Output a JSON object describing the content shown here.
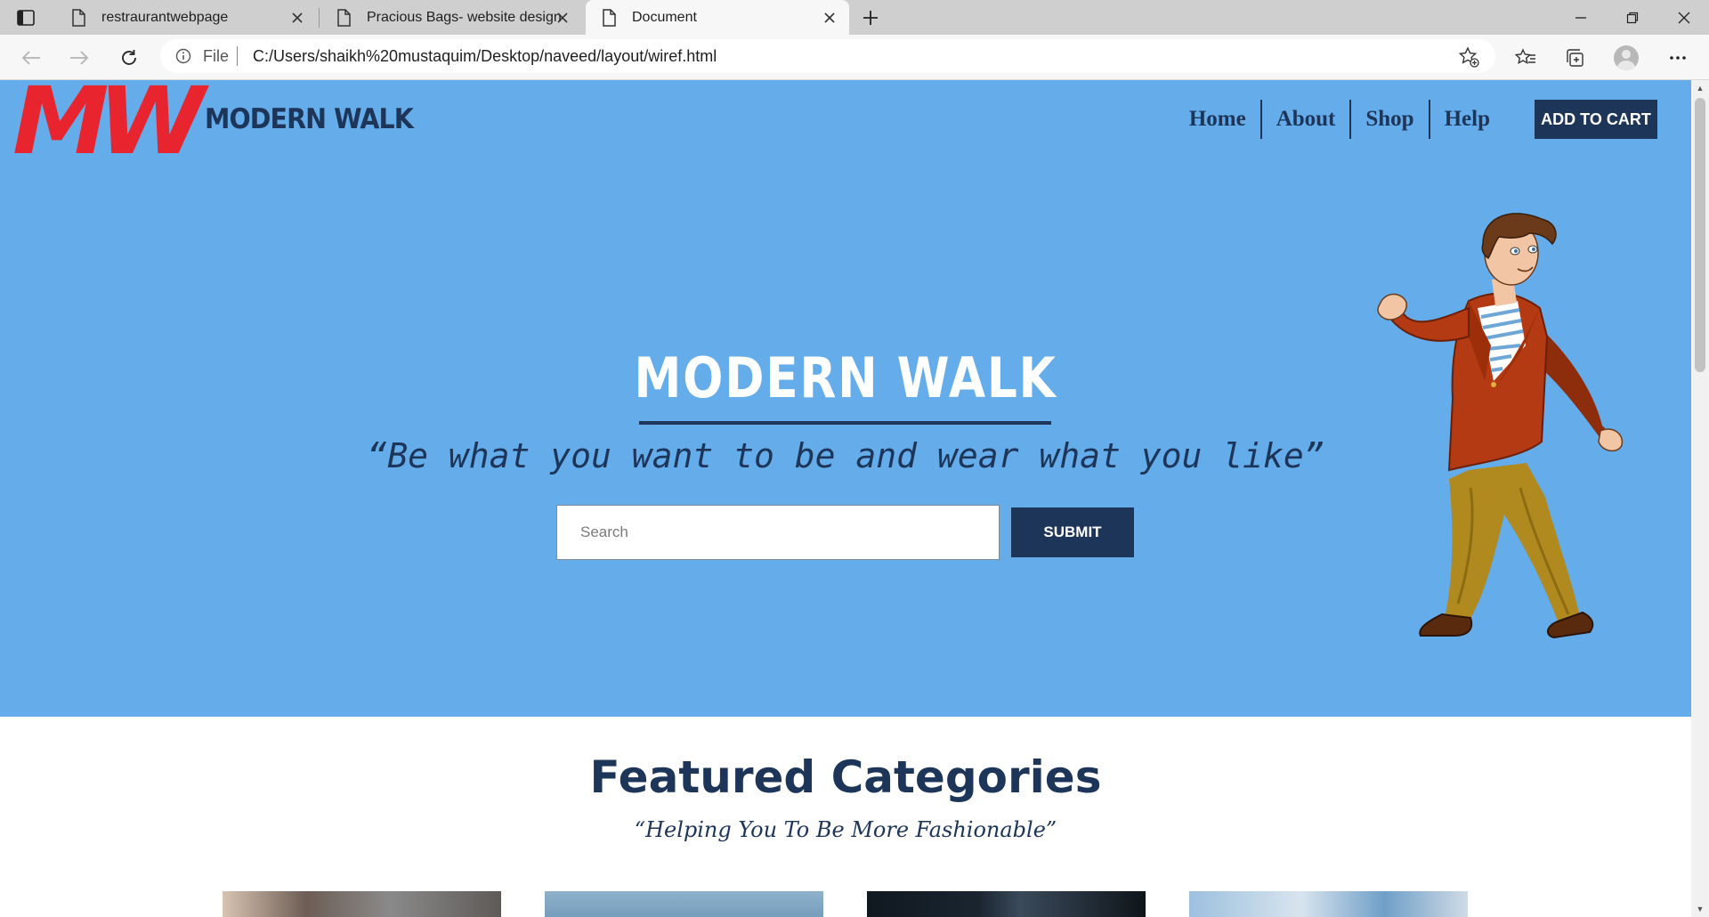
{
  "browser": {
    "tabs": [
      {
        "title": "restraurantwebpage",
        "active": false
      },
      {
        "title": "Pracious Bags- website design",
        "active": false
      },
      {
        "title": "Document",
        "active": true
      }
    ],
    "address": {
      "scheme_label": "File",
      "url": "C:/Users/shaikh%20mustaquim/Desktop/naveed/layout/wiref.html"
    }
  },
  "site": {
    "logo": {
      "mark": "MW",
      "name": "MODERN WALK"
    },
    "nav": [
      {
        "label": "Home"
      },
      {
        "label": "About"
      },
      {
        "label": "Shop"
      },
      {
        "label": "Help"
      }
    ],
    "cart_label": "ADD TO CART"
  },
  "hero": {
    "title": "MODERN WALK",
    "quote": "“Be what you want to be and wear what you like”",
    "search": {
      "placeholder": "Search",
      "value": ""
    },
    "submit_label": "SUBMIT"
  },
  "featured": {
    "title": "Featured Categories",
    "subtitle": "“Helping You To Be More Fashionable”"
  },
  "colors": {
    "hero_bg": "#64acea",
    "navy": "#1d3558",
    "logo_red": "#e8242e"
  },
  "icons": [
    "sidebar-toggle-icon",
    "document-icon",
    "close-icon",
    "plus-icon",
    "minimize-icon",
    "restore-icon",
    "back-arrow-icon",
    "forward-arrow-icon",
    "refresh-icon",
    "info-icon",
    "add-favorite-icon",
    "favorites-icon",
    "collections-icon",
    "profile-icon",
    "more-icon"
  ]
}
